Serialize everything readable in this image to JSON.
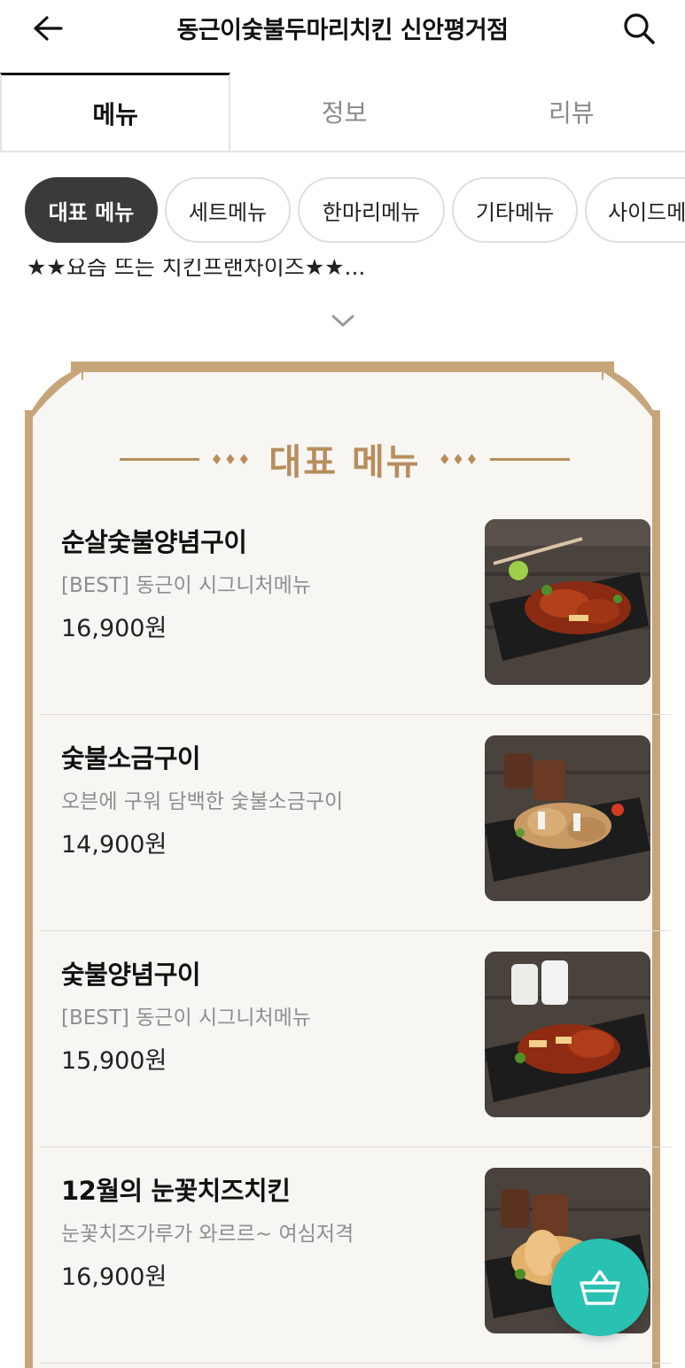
{
  "header": {
    "title": "동근이숯불두마리치킨 신안평거점",
    "back_icon": "arrow-left-icon",
    "search_icon": "search-icon"
  },
  "tabs": [
    {
      "label": "메뉴",
      "active": true
    },
    {
      "label": "정보",
      "active": false
    },
    {
      "label": "리뷰",
      "active": false
    }
  ],
  "categories": [
    {
      "label": "대표 메뉴",
      "active": true
    },
    {
      "label": "세트메뉴",
      "active": false
    },
    {
      "label": "한마리메뉴",
      "active": false
    },
    {
      "label": "기타메뉴",
      "active": false
    },
    {
      "label": "사이드메뉴",
      "active": false
    }
  ],
  "notice": {
    "text": "★★요즘 뜨는 치킨프랜차이즈★★..."
  },
  "board": {
    "title": "대표 메뉴",
    "deco": "♦♦♦",
    "accent_color": "#c7a57a"
  },
  "menu_items": [
    {
      "name": "순살숯불양념구이",
      "desc": "[BEST] 동근이 시그니처메뉴",
      "price": "16,900원",
      "image": "spicy-chicken-image"
    },
    {
      "name": "숯불소금구이",
      "desc": "오븐에 구워 담백한 숯불소금구이",
      "price": "14,900원",
      "image": "salt-chicken-image"
    },
    {
      "name": "숯불양념구이",
      "desc": "[BEST] 동근이 시그니처메뉴",
      "price": "15,900원",
      "image": "sauce-chicken-image"
    },
    {
      "name": "12월의 눈꽃치즈치킨",
      "desc": "눈꽃치즈가루가 와르르~ 여심저격",
      "price": "16,900원",
      "image": "cheese-chicken-image"
    }
  ],
  "cart": {
    "icon": "basket-icon",
    "color": "#29c1b2"
  }
}
